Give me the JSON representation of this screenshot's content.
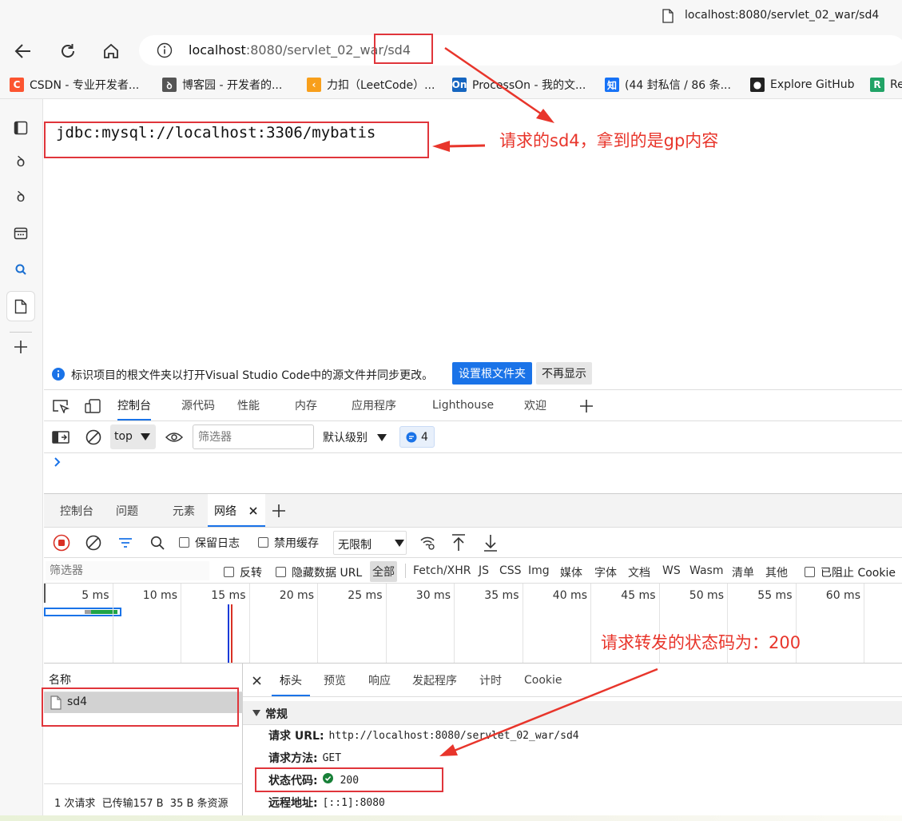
{
  "browser": {
    "window_title": "localhost:8080/servlet_02_war/sd4",
    "url_host": "localhost",
    "url_rest": ":8080/servlet_02_war/sd4",
    "favorites": [
      {
        "label": "CSDN - 专业开发者...",
        "icon": "csdn-icon",
        "color": "#fc5531",
        "glyph": "C"
      },
      {
        "label": "博客园 - 开发者的...",
        "icon": "cnblogs-icon",
        "color": "#555555",
        "glyph": "ꝺ"
      },
      {
        "label": "力扣（LeetCode）...",
        "icon": "leetcode-icon",
        "color": "#f89f1b",
        "glyph": "‹"
      },
      {
        "label": "ProcessOn - 我的文...",
        "icon": "processon-icon",
        "color": "#1565c0",
        "glyph": "On"
      },
      {
        "label": "(44 封私信 / 86 条...",
        "icon": "zhihu-icon",
        "color": "#1772f6",
        "glyph": "知"
      },
      {
        "label": "Explore GitHub",
        "icon": "github-icon",
        "color": "#222222",
        "glyph": "●"
      },
      {
        "label": "Re",
        "icon": "r-icon",
        "color": "#21a366",
        "glyph": "R"
      }
    ]
  },
  "page": {
    "content": "jdbc:mysql://localhost:3306/mybatis"
  },
  "annotations": {
    "top": "请求的sd4，拿到的是gp内容",
    "middle": "请求转发的状态码为：200",
    "color": "#e8352b"
  },
  "infobar": {
    "text": "标识项目的根文件夹以打开Visual Studio Code中的源文件并同步更改。",
    "primary_button": "设置根文件夹",
    "secondary_button": "不再显示"
  },
  "devtools": {
    "main_tabs": [
      "控制台",
      "源代码",
      "性能",
      "内存",
      "应用程序",
      "Lighthouse",
      "欢迎"
    ],
    "console_toolbar": {
      "context": "top",
      "filter_placeholder": "筛选器",
      "level": "默认级别",
      "issues_count": "4"
    },
    "drawer_tabs": [
      "控制台",
      "问题",
      "元素",
      "网络"
    ],
    "network_toolbar": {
      "preserve_log": "保留日志",
      "disable_cache": "禁用缓存",
      "throttle": "无限制"
    },
    "filter_row": {
      "placeholder": "筛选器",
      "invert": "反转",
      "hide_data_urls": "隐藏数据 URL",
      "types": [
        "全部",
        "Fetch/XHR",
        "JS",
        "CSS",
        "Img",
        "媒体",
        "字体",
        "文档",
        "WS",
        "Wasm",
        "清单",
        "其他"
      ],
      "blocked_cookies": "已阻止 Cookie"
    },
    "timeline_ticks": [
      "5 ms",
      "10 ms",
      "15 ms",
      "20 ms",
      "25 ms",
      "30 ms",
      "35 ms",
      "40 ms",
      "45 ms",
      "50 ms",
      "55 ms",
      "60 ms"
    ],
    "request_list": {
      "header": "名称",
      "rows": [
        "sd4"
      ],
      "status_bar": "1 次请求  已传输157 B  35 B 条资源"
    },
    "detail": {
      "tabs": [
        "标头",
        "预览",
        "响应",
        "发起程序",
        "计时",
        "Cookie"
      ],
      "section": "常规",
      "rows": [
        {
          "key": "请求 URL:",
          "value": "http://localhost:8080/servlet_02_war/sd4"
        },
        {
          "key": "请求方法:",
          "value": "GET"
        },
        {
          "key": "状态代码:",
          "value": "200"
        },
        {
          "key": "远程地址:",
          "value": "[::1]:8080"
        }
      ]
    }
  }
}
